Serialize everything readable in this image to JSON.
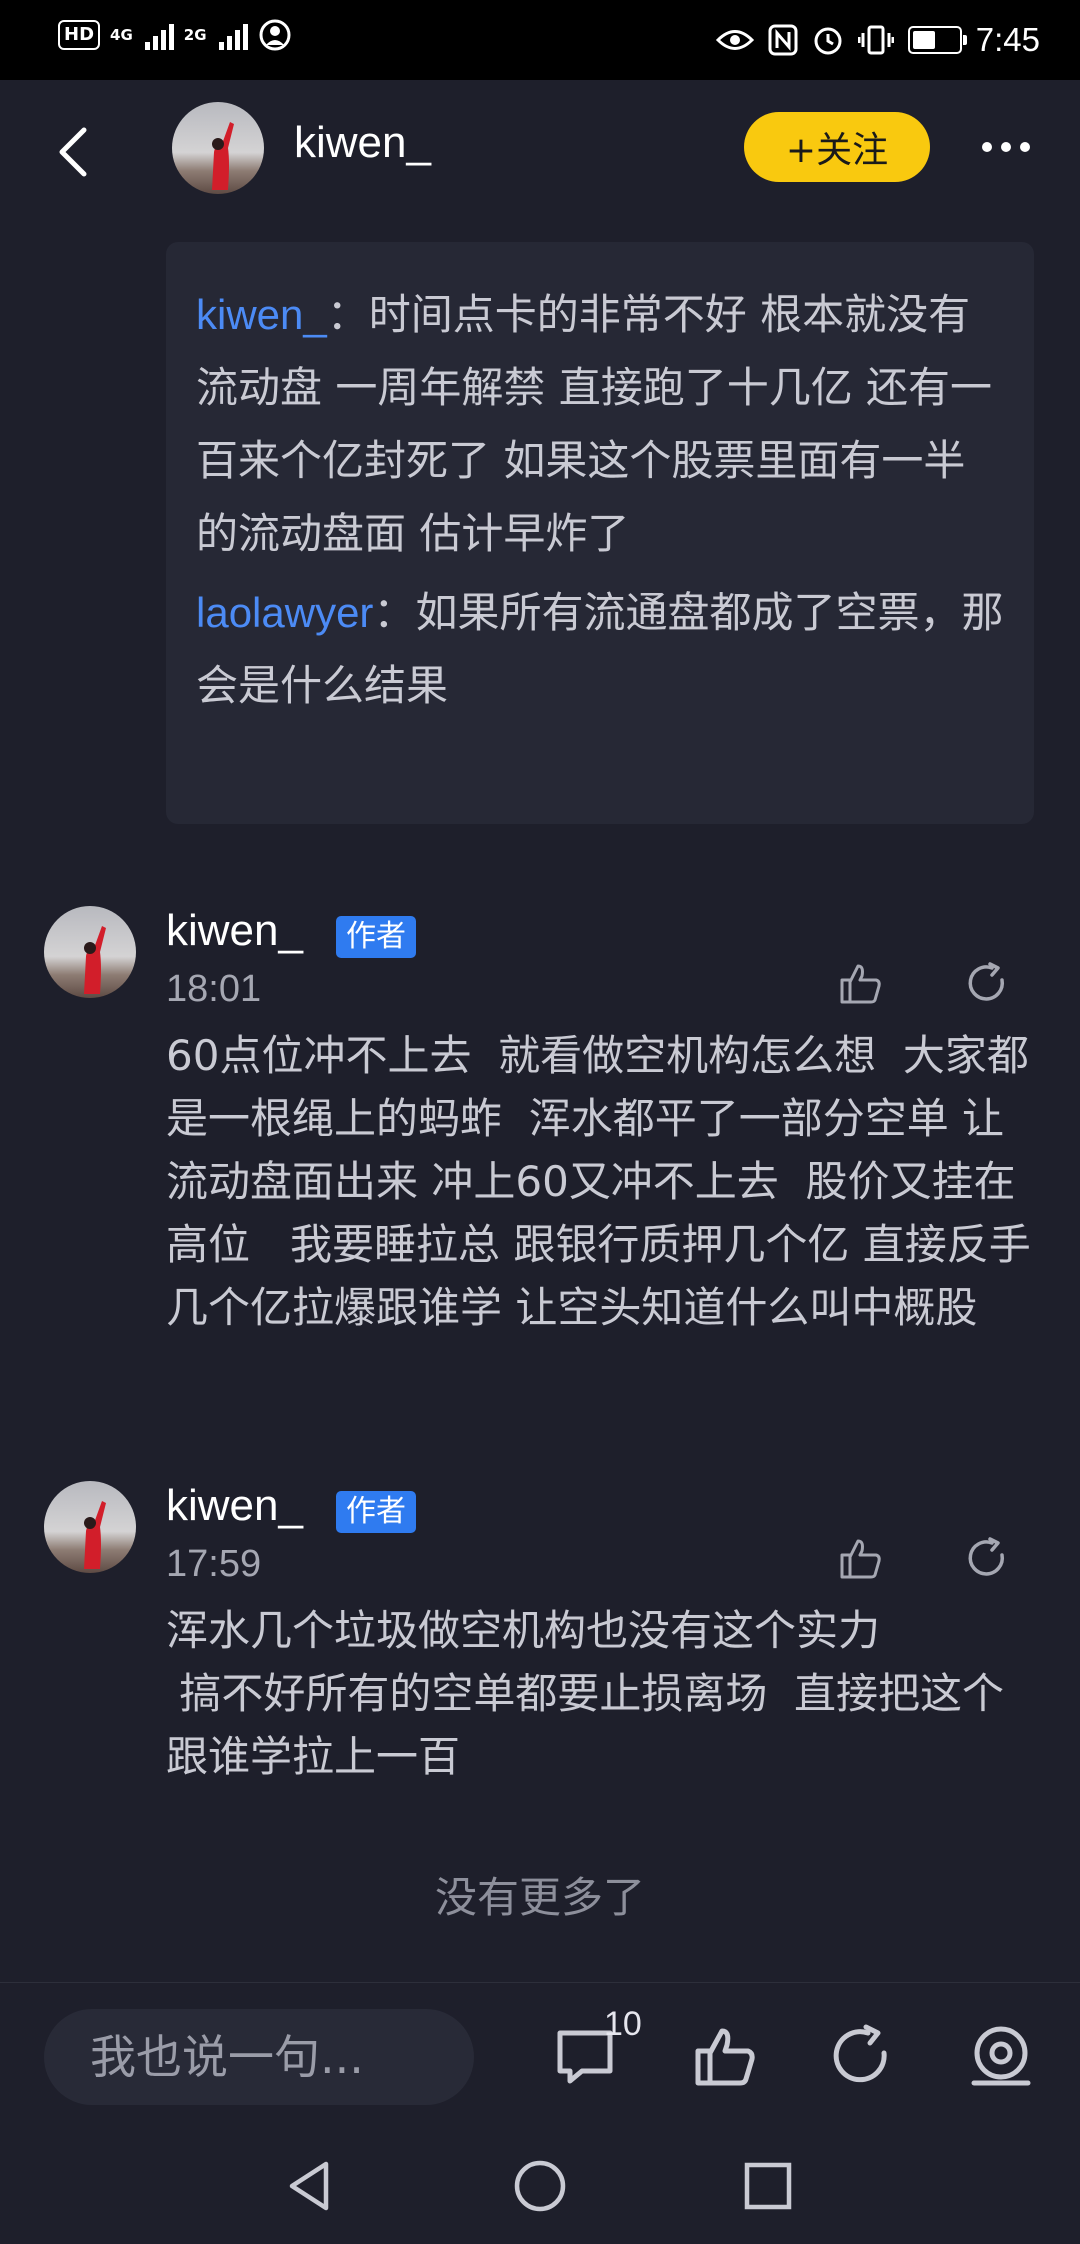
{
  "status_bar": {
    "left_chip": "HD",
    "net1": "4G",
    "net2": "2G",
    "time": "7:45"
  },
  "header": {
    "username": "kiwen_",
    "follow_label": "+关注"
  },
  "quoted_thread": [
    {
      "name": "kiwen_",
      "separator": "：",
      "text": "时间点卡的非常不好  根本就没有流动盘  一周年解禁  直接跑了十几亿   还有一百来个亿封死了   如果这个股票里面有一半的流动盘面   估计早炸了"
    },
    {
      "name": "laolawyer",
      "separator": "：",
      "text": "如果所有流通盘都成了空票，那会是什么结果"
    }
  ],
  "comments": [
    {
      "name": "kiwen_",
      "badge": "作者",
      "time": "18:01",
      "text": "60点位冲不上去  就看做空机构怎么想  大家都是一根绳上的蚂蚱  浑水都平了一部分空单 让流动盘面出来 冲上60又冲不上去  股价又挂在高位   我要睡拉总 跟银行质押几个亿 直接反手几个亿拉爆跟谁学 让空头知道什么叫中概股"
    },
    {
      "name": "kiwen_",
      "badge": "作者",
      "time": "17:59",
      "text": "浑水几个垃圾做空机构也没有这个实力\n 搞不好所有的空单都要止损离场  直接把这个跟谁学拉上一百"
    }
  ],
  "end_notice": "没有更多了",
  "bottom_bar": {
    "input_placeholder": "我也说一句...",
    "comment_count": "10"
  },
  "colors": {
    "background": "#1e1f2b",
    "accent_yellow": "#f9c90f",
    "link_blue": "#4c8bf5",
    "badge_blue": "#2f7bf0"
  }
}
